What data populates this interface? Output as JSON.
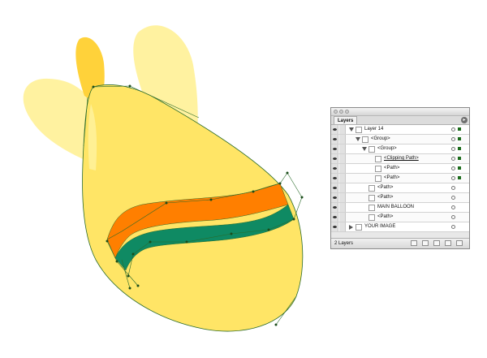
{
  "artwork": {
    "colors": {
      "balloon": "#ffe566",
      "balloon_shadow": "#ffd23a",
      "light_shape": "#fff2a0",
      "band_orange": "#ff7f00",
      "band_green": "#0f8a63",
      "path_stroke": "#2a6b2a",
      "anchor": "#1b4d1b"
    }
  },
  "layers_panel": {
    "tab": "Layers",
    "menu_icon": "triangle-menu-icon",
    "rows": [
      {
        "label": "Layer 14",
        "indent": 0,
        "expander": "open"
      },
      {
        "label": "<Group>",
        "indent": 1,
        "expander": "open"
      },
      {
        "label": "<Group>",
        "indent": 2,
        "expander": "open"
      },
      {
        "label": "<Clipping Path>",
        "indent": 3,
        "expander": "none"
      },
      {
        "label": "<Path>",
        "indent": 3,
        "expander": "none"
      },
      {
        "label": "<Path>",
        "indent": 3,
        "expander": "none"
      },
      {
        "label": "<Path>",
        "indent": 2,
        "expander": "none"
      },
      {
        "label": "<Path>",
        "indent": 2,
        "expander": "none"
      },
      {
        "label": "MAIN BALLOON",
        "indent": 2,
        "expander": "none"
      },
      {
        "label": "<Path>",
        "indent": 2,
        "expander": "none"
      },
      {
        "label": "YOUR IMAGE",
        "indent": 0,
        "expander": "closed"
      }
    ],
    "footer_count": "2 Layers"
  }
}
